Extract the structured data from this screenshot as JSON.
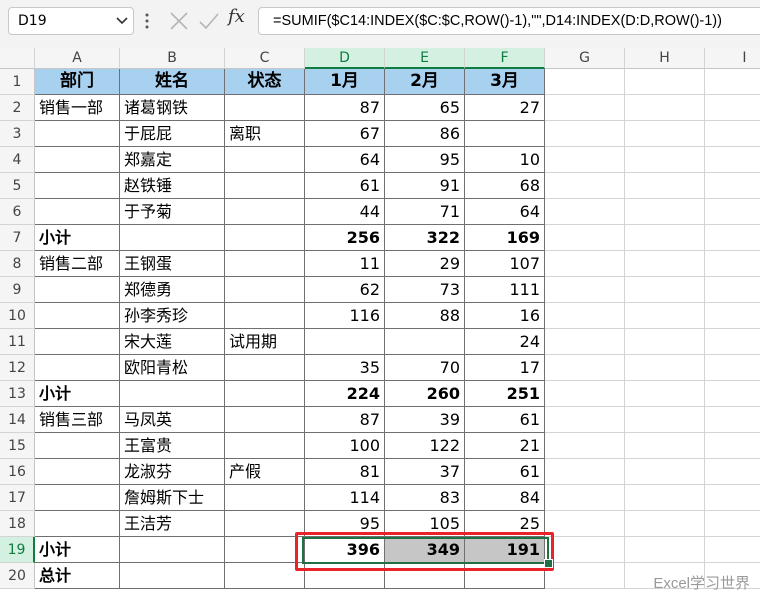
{
  "formula_bar": {
    "name_box": "D19",
    "formula": "=SUMIF($C14:INDEX($C:$C,ROW()-1),\"\",D14:INDEX(D:D,ROW()-1))",
    "fx_label": "fx"
  },
  "columns": [
    "A",
    "B",
    "C",
    "D",
    "E",
    "F",
    "G",
    "H",
    "I"
  ],
  "rows": [
    [
      "部门",
      "姓名",
      "状态",
      "1月",
      "2月",
      "3月"
    ],
    [
      "销售一部",
      "诸葛钢铁",
      "",
      "87",
      "65",
      "27"
    ],
    [
      "",
      "于屁屁",
      "离职",
      "67",
      "86",
      ""
    ],
    [
      "",
      "郑嘉定",
      "",
      "64",
      "95",
      "10"
    ],
    [
      "",
      "赵铁锤",
      "",
      "61",
      "91",
      "68"
    ],
    [
      "",
      "于予菊",
      "",
      "44",
      "71",
      "64"
    ],
    [
      "小计",
      "",
      "",
      "256",
      "322",
      "169"
    ],
    [
      "销售二部",
      "王钢蛋",
      "",
      "11",
      "29",
      "107"
    ],
    [
      "",
      "郑德勇",
      "",
      "62",
      "73",
      "111"
    ],
    [
      "",
      "孙李秀珍",
      "",
      "116",
      "88",
      "16"
    ],
    [
      "",
      "宋大莲",
      "试用期",
      "",
      "",
      "24"
    ],
    [
      "",
      "欧阳青松",
      "",
      "35",
      "70",
      "17"
    ],
    [
      "小计",
      "",
      "",
      "224",
      "260",
      "251"
    ],
    [
      "销售三部",
      "马凤英",
      "",
      "87",
      "39",
      "61"
    ],
    [
      "",
      "王富贵",
      "",
      "100",
      "122",
      "21"
    ],
    [
      "",
      "龙淑芬",
      "产假",
      "81",
      "37",
      "61"
    ],
    [
      "",
      "詹姆斯下士",
      "",
      "114",
      "83",
      "84"
    ],
    [
      "",
      "王洁芳",
      "",
      "95",
      "105",
      "25"
    ],
    [
      "小计",
      "",
      "",
      "396",
      "349",
      "191"
    ],
    [
      "总计",
      "",
      "",
      "",
      "",
      ""
    ]
  ],
  "selected_cell": "D19",
  "watermark": "Excel学习世界",
  "colors": {
    "header_fill": "#a8d1f0",
    "selection_border": "#1e7145",
    "highlight_red": "#e8232a",
    "selected_fill": "#c6c6c6"
  }
}
